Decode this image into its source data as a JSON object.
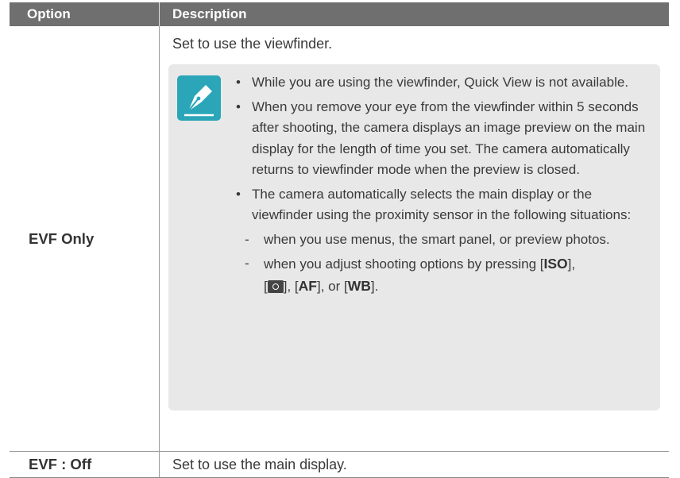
{
  "header": {
    "option": "Option",
    "description": "Description"
  },
  "rows": [
    {
      "option": "EVF Only",
      "lead": "Set to use the viewfinder.",
      "notes": [
        "While you are using the viewfinder, Quick View is not available.",
        "When you remove your eye from the viewfinder within 5 seconds after shooting, the camera displays an image preview on the main display for the length of time you set. The camera automatically returns to viewfinder mode when the preview is closed.",
        "The camera automatically selects the main display or the viewfinder using the proximity sensor in the following situations:"
      ],
      "subnotes": {
        "item1": "when you use menus, the smart panel, or preview photos.",
        "item2_prefix": "when you adjust shooting options by pressing [",
        "iso": "ISO",
        "sep1": "],",
        "br_open": "[",
        "sep2": "], [",
        "af": "AF",
        "sep3": "], or [",
        "wb": "WB",
        "end": "]."
      }
    },
    {
      "option": "EVF : Off",
      "description": "Set to use the main display."
    }
  ],
  "colors": {
    "header_bg": "#6f6f6f",
    "note_bg": "#e8e8e8",
    "icon_teal": "#2aa6b8"
  },
  "icons": {
    "note": "pen-nib-note-icon",
    "metering": "metering-icon"
  }
}
